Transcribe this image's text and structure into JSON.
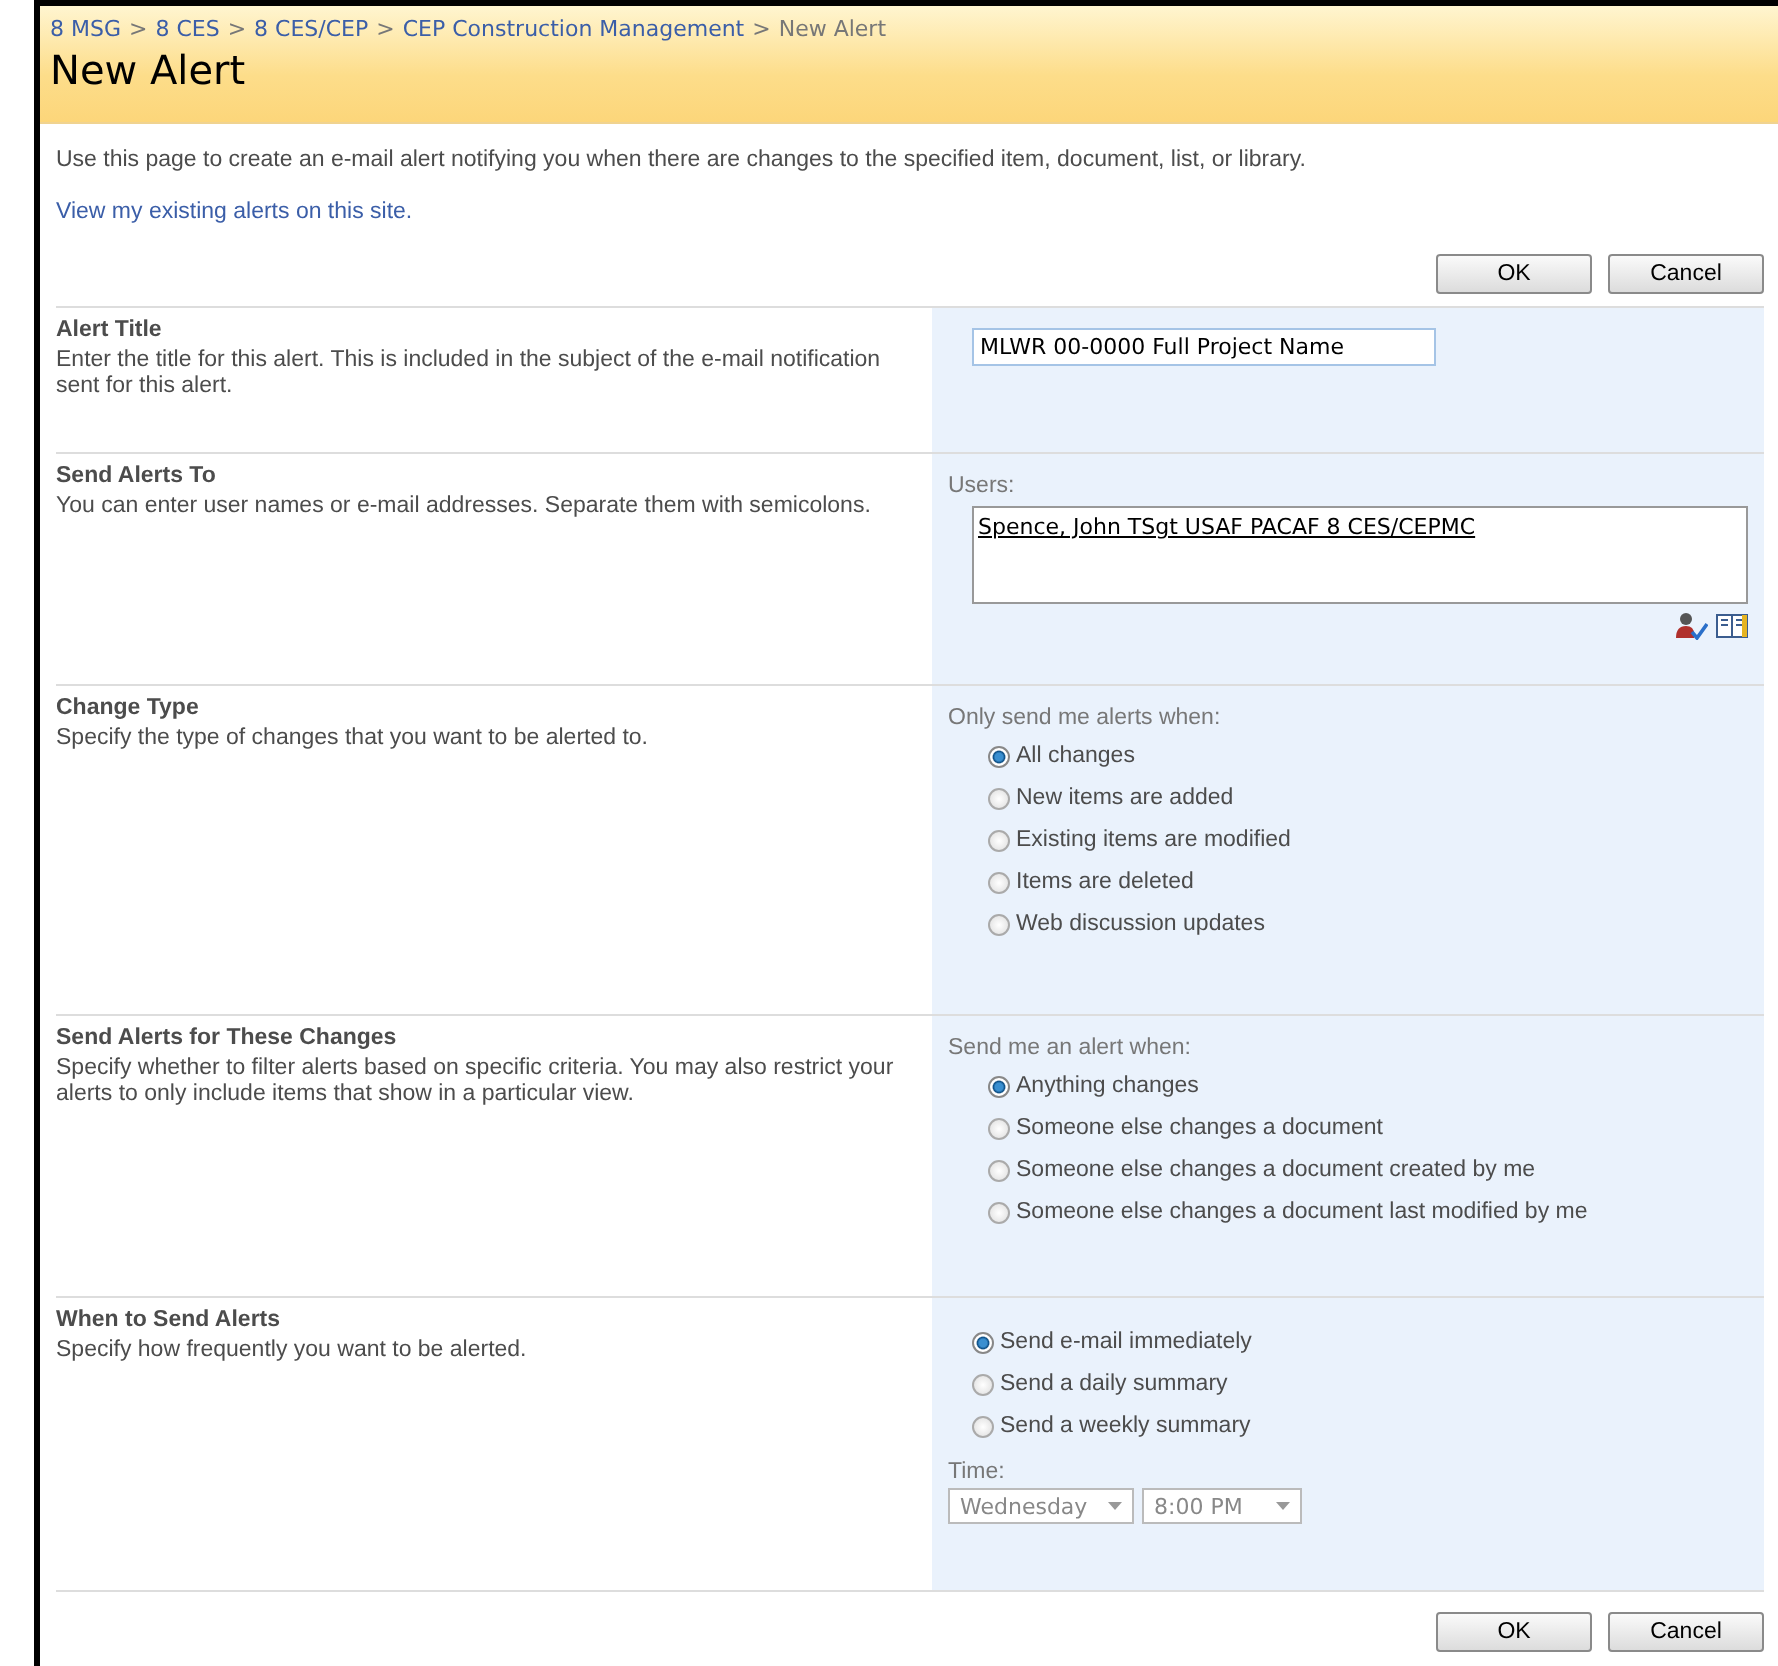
{
  "breadcrumb": [
    {
      "label": "8 MSG",
      "kind": "link"
    },
    {
      "label": "8 CES",
      "kind": "link"
    },
    {
      "label": "8 CES/CEP",
      "kind": "link"
    },
    {
      "label": "CEP Construction Management",
      "kind": "link"
    },
    {
      "label": "New Alert",
      "kind": "current"
    }
  ],
  "breadcrumb_separator": ">",
  "title": "New Alert",
  "intro": "Use this page to create an e-mail alert notifying you when there are changes to the specified item, document, list, or library.",
  "existing_alerts_link": "View my existing alerts on this site.",
  "top_buttons": [
    "OK",
    "Cancel"
  ],
  "sections": [
    {
      "kind": "textbox",
      "title": "Alert Title",
      "description": "Enter the title for this alert. This is included in the subject of the e-mail notification sent for this alert.",
      "value": "MLWR 00-0000 Full Project Name"
    },
    {
      "kind": "people",
      "title": "Send Alerts To",
      "description": "You can enter user names or e-mail addresses. Separate them with semicolons.",
      "label": "Users:",
      "value": "Spence, John TSgt USAF PACAF 8 CES/CEPMC"
    },
    {
      "kind": "radios",
      "title": "Change Type",
      "description": "Specify the type of changes that you want to be alerted to.",
      "label": "Only send me alerts when:",
      "options": [
        {
          "label": "All changes",
          "selected": true
        },
        {
          "label": "New items are added",
          "selected": false
        },
        {
          "label": "Existing items are modified",
          "selected": false
        },
        {
          "label": "Items are deleted",
          "selected": false
        },
        {
          "label": "Web discussion updates",
          "selected": false
        }
      ]
    },
    {
      "kind": "radios",
      "title": "Send Alerts for These Changes",
      "description": "Specify whether to filter alerts based on specific criteria. You may also restrict your alerts to only include items that show in a particular view.",
      "label": "Send me an alert when:",
      "options": [
        {
          "label": "Anything changes",
          "selected": true
        },
        {
          "label": "Someone else changes a document",
          "selected": false
        },
        {
          "label": "Someone else changes a document created by me",
          "selected": false
        },
        {
          "label": "Someone else changes a document last modified by me",
          "selected": false
        }
      ]
    },
    {
      "kind": "schedule",
      "title": "When to Send Alerts",
      "description": "Specify how frequently you want to be alerted.",
      "options": [
        {
          "label": "Send e-mail immediately",
          "selected": true
        },
        {
          "label": "Send a daily summary",
          "selected": false
        },
        {
          "label": "Send a weekly summary",
          "selected": false
        }
      ],
      "time_label": "Time:",
      "day": {
        "value": "Wednesday",
        "disabled": true
      },
      "time": {
        "value": "8:00 PM",
        "disabled": true
      }
    }
  ],
  "bottom_buttons": [
    "OK",
    "Cancel"
  ]
}
